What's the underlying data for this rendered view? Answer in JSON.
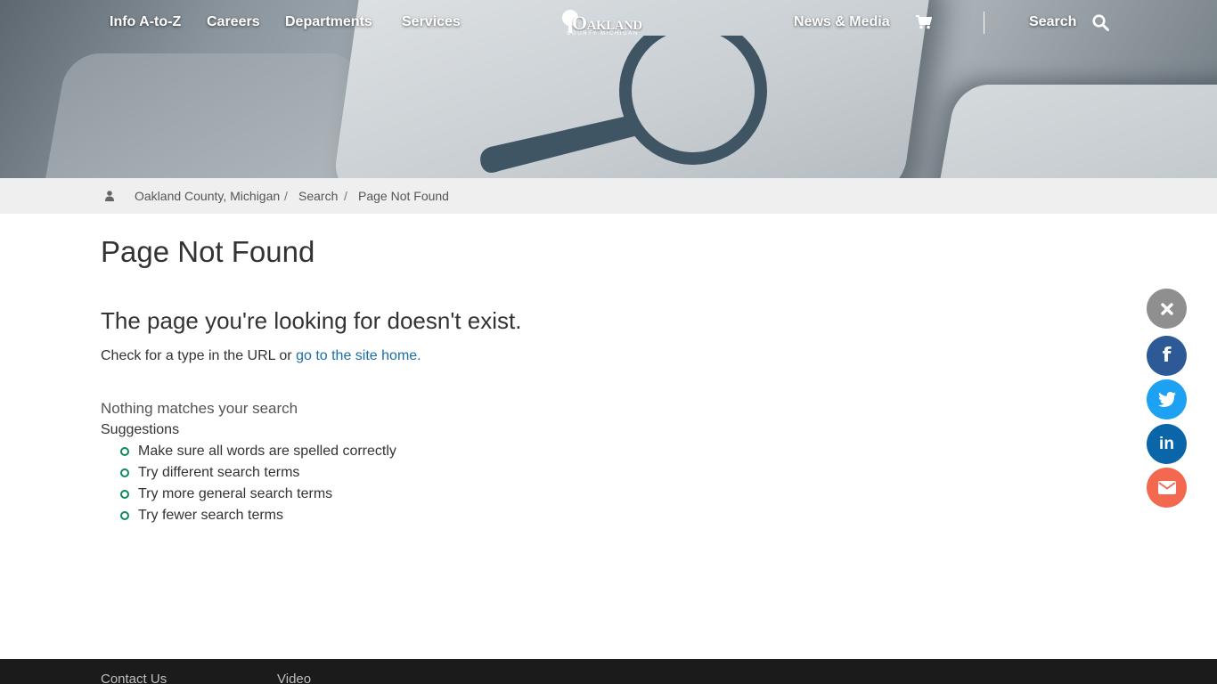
{
  "nav": {
    "left_items": [
      "Info A-to-Z",
      "Careers",
      "Departments",
      "Services"
    ],
    "right_items": [
      "News & Media"
    ],
    "search_label": "Search",
    "cart_icon": "shopping-cart-icon",
    "search_icon": "search-icon"
  },
  "logo": {
    "word": "Oakland",
    "sub": "COUNTY MICHIGAN"
  },
  "breadcrumb": {
    "home_icon": "user-icon",
    "items": [
      "Oakland County, Michigan",
      "Search",
      "Page Not Found"
    ],
    "separator": "/"
  },
  "main": {
    "title": "Page Not Found",
    "subtitle": "The page you're looking for doesn't exist.",
    "check_text": "Check for a type in the URL or",
    "home_link": "go to the site home.",
    "nothing_matches": "Nothing matches your search",
    "suggestions_heading": "Suggestions",
    "suggestions": [
      "Make sure all words are spelled correctly",
      "Try different search terms",
      "Try more general search terms",
      "Try fewer search terms"
    ]
  },
  "social": {
    "buttons": [
      {
        "name": "close-icon",
        "color": "#8f8f8f"
      },
      {
        "name": "facebook-icon",
        "color": "#2d5a96",
        "glyph": "f"
      },
      {
        "name": "twitter-icon",
        "color": "#1da1f2"
      },
      {
        "name": "linkedin-icon",
        "color": "#0a66a8",
        "glyph": "in"
      },
      {
        "name": "email-icon",
        "color": "#f2694f"
      }
    ]
  },
  "footer": {
    "links": [
      "Contact Us",
      "Video"
    ]
  },
  "colors": {
    "link": "#1a6ea8",
    "bullet": "#0f8a5a",
    "footer_bg": "#1b1b1b",
    "breadcrumb_bg": "#efefef"
  }
}
